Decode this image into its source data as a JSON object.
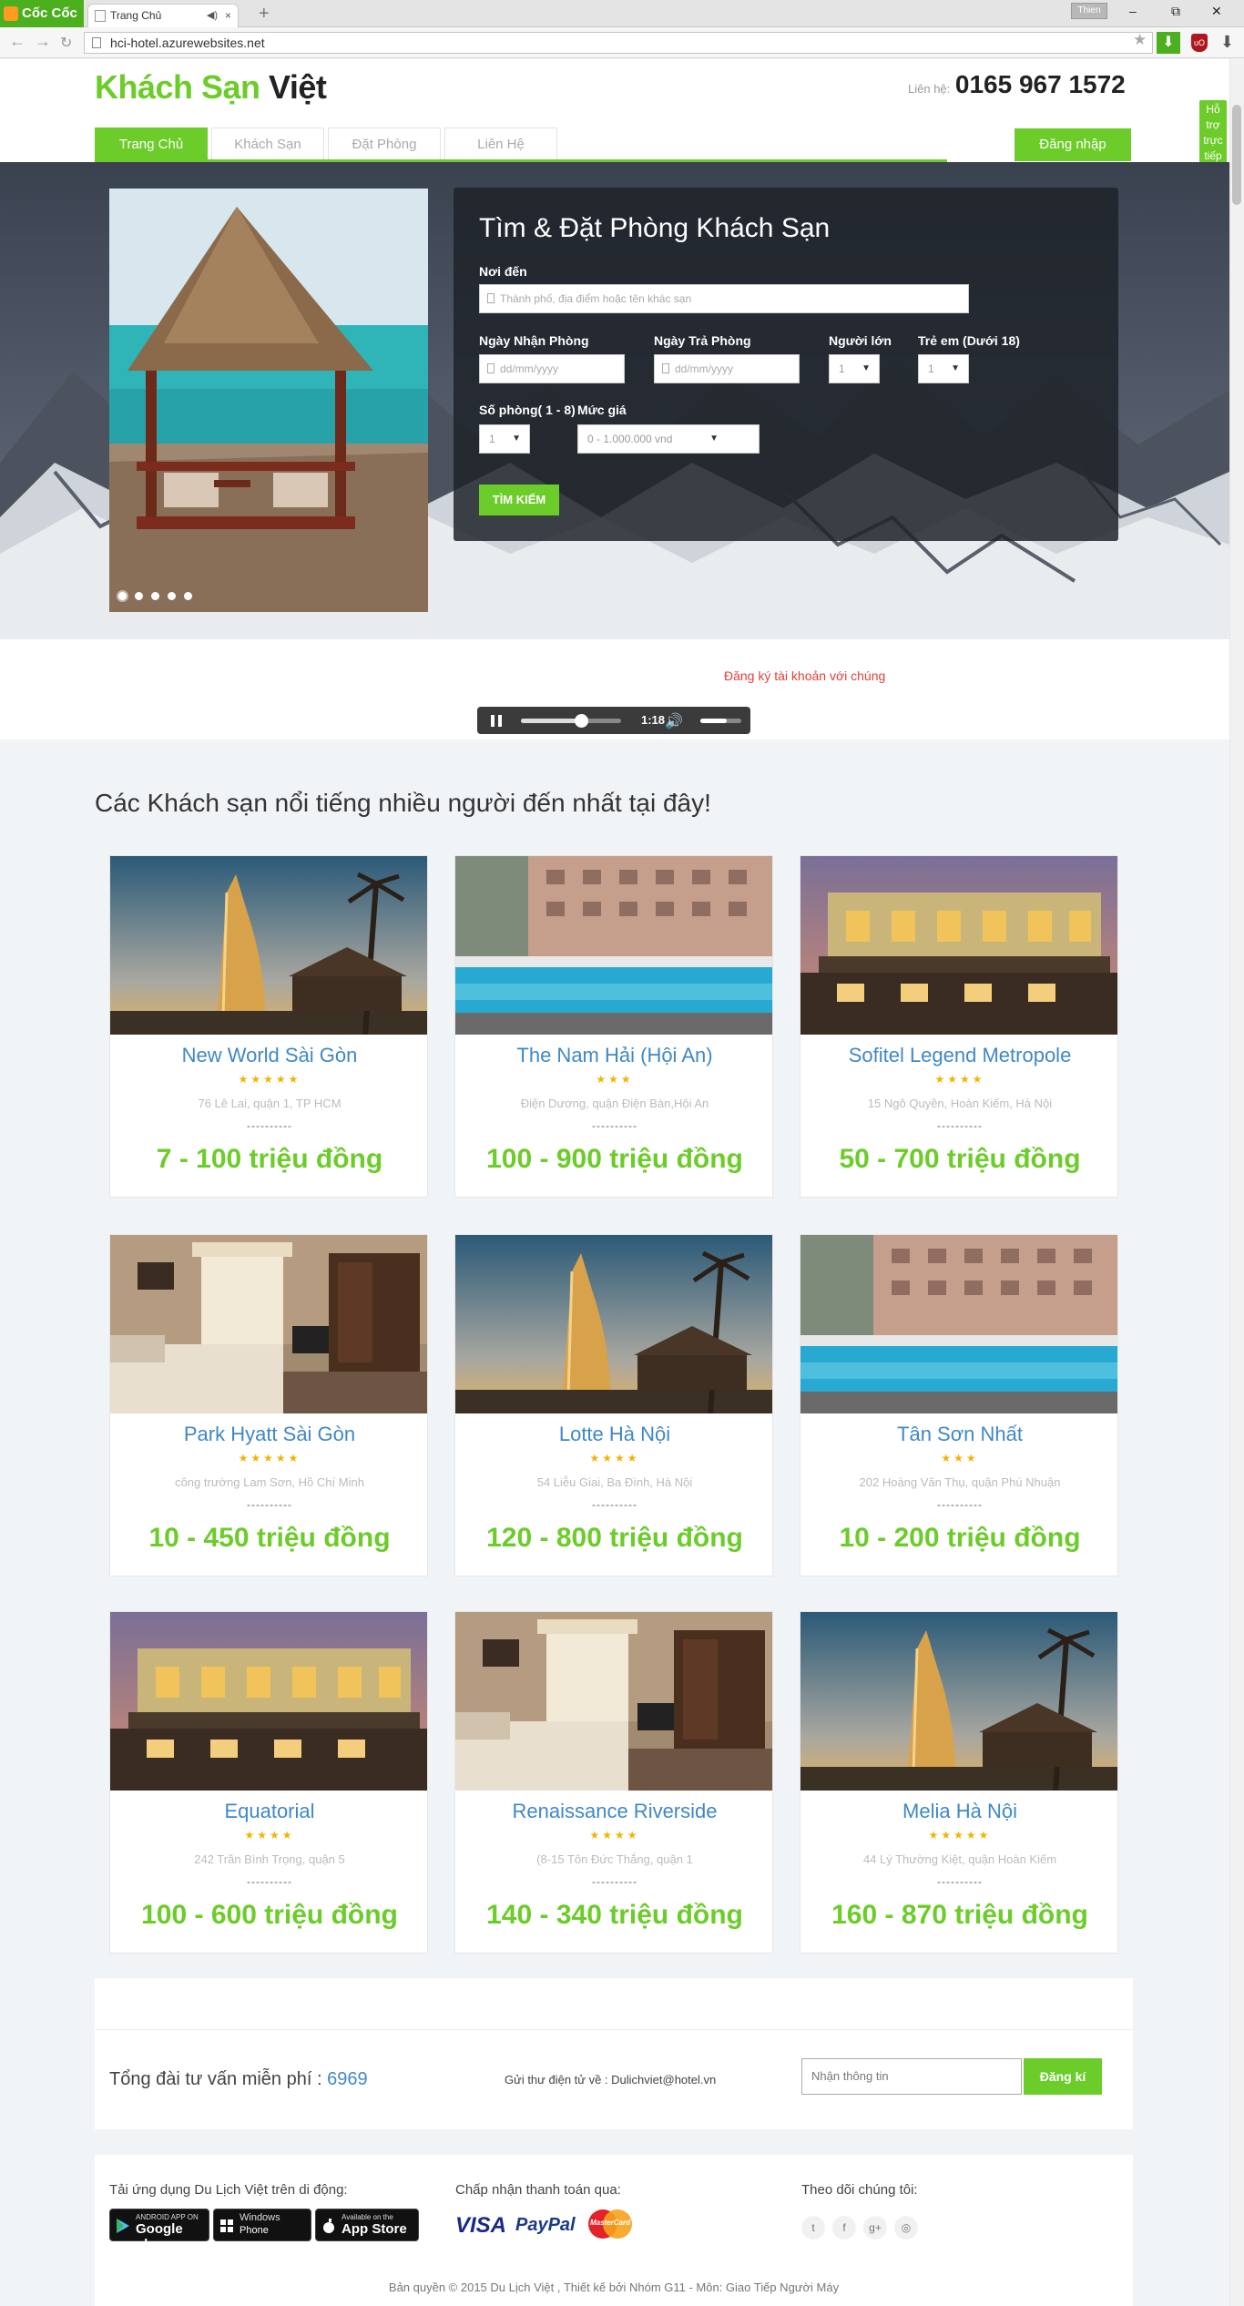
{
  "browser": {
    "brand": "Cốc Cốc",
    "tab_title": "Trang Chủ",
    "tab_sound_icon": "speaker-icon",
    "tab_close": "×",
    "new_tab": "+",
    "user_badge": "Thien",
    "url": "hci-hotel.azurewebsites.net",
    "win_min": "–",
    "win_max": "⧉",
    "win_close": "✕"
  },
  "header": {
    "logo_part1": "Khách Sạn",
    "logo_part2": " Việt",
    "contact_label": "Liên hệ:",
    "contact_phone": "0165 967 1572",
    "nav": [
      {
        "label": "Trang Chủ",
        "active": true
      },
      {
        "label": "Khách Sạn",
        "active": false
      },
      {
        "label": "Đặt Phòng",
        "active": false
      },
      {
        "label": "Liên Hệ",
        "active": false
      }
    ],
    "login_label": "Đăng nhập",
    "support_label": "Hỗ trợ trực tiếp"
  },
  "search": {
    "title": "Tìm & Đặt Phòng Khách Sạn",
    "destination_label": "Nơi đến",
    "destination_placeholder": "Thành phố, địa điểm hoặc tên khác sạn",
    "checkin_label": "Ngày Nhận Phòng",
    "checkin_placeholder": "dd/mm/yyyy",
    "checkout_label": "Ngày Trả Phòng",
    "checkout_placeholder": "dd/mm/yyyy",
    "adults_label": "Người lớn",
    "adults_value": "1",
    "children_label": "Trẻ em (Dưới 18)",
    "children_value": "1",
    "rooms_label": "Số phòng( 1 - 8)",
    "rooms_value": "1",
    "price_label": "Mức giá",
    "price_value": "0 - 1.000.000 vnd",
    "search_button": "TÌM KIẾM"
  },
  "slider": {
    "dots": 5,
    "active_dot": 0
  },
  "register": {
    "link": "Đăng ký tài khoản với chúng"
  },
  "player": {
    "time": "1:18",
    "progress": 0.6,
    "volume": 0.65
  },
  "hotels": {
    "section_title": "Các Khách sạn nổi tiếng nhiều người đến nhất tại đây!",
    "separator": "----------",
    "items": [
      {
        "name": "New World Sài Gòn",
        "stars": "★★★★★",
        "address": "76 Lê Lai, quận 1, TP HCM",
        "price": "7 - 100 triệu đồng",
        "image": "burj"
      },
      {
        "name": "The Nam Hải (Hội An)",
        "stars": "★★★",
        "address": "Điện Dương, quận Điện Bàn,Hội An",
        "price": "100 - 900 triệu đồng",
        "image": "pool"
      },
      {
        "name": "Sofitel Legend Metropole",
        "stars": "★★★★",
        "address": "15 Ngô Quyền, Hoàn Kiếm, Hà Nội",
        "price": "50 - 700 triệu đồng",
        "image": "facade"
      },
      {
        "name": "Park Hyatt Sài Gòn",
        "stars": "★★★★★",
        "address": "công trường Lam Sơn, Hồ Chí Minh",
        "price": "10 - 450 triệu đồng",
        "image": "room"
      },
      {
        "name": "Lotte Hà Nội",
        "stars": "★★★★",
        "address": "54 Liễu Giai, Ba Đình, Hà Nội",
        "price": "120 - 800 triệu đồng",
        "image": "burj"
      },
      {
        "name": "Tân Sơn Nhất",
        "stars": "★★★",
        "address": "202 Hoàng Văn Thụ, quận Phú Nhuận",
        "price": "10 - 200 triệu đồng",
        "image": "pool"
      },
      {
        "name": "Equatorial",
        "stars": "★★★★",
        "address": "242 Trần Bình Trọng, quận 5",
        "price": "100 - 600 triệu đồng",
        "image": "facade"
      },
      {
        "name": "Renaissance Riverside",
        "stars": "★★★★",
        "address": "(8-15 Tôn Đức Thắng, quận 1",
        "price": "140 - 340 triệu đồng",
        "image": "room"
      },
      {
        "name": "Melia Hà Nội",
        "stars": "★★★★★",
        "address": "44 Lý Thường Kiệt, quận Hoàn Kiếm",
        "price": "160 - 870 triệu đồng",
        "image": "burj"
      }
    ]
  },
  "newsletter": {
    "hotline_label": "Tổng đài tư vấn miễn phí :",
    "hotline_number": "6969",
    "email_text": "Gửi thư điện tử về : Dulichviet@hotel.vn",
    "input_placeholder": "Nhận thông tin",
    "subscribe_button": "Đăng kí"
  },
  "footer": {
    "apps_heading": "Tải ứng dụng Du Lịch Việt trên di động:",
    "stores": [
      {
        "small": "ANDROID APP ON",
        "big": "Google play",
        "icon": "play-store-icon"
      },
      {
        "small": "Windows",
        "big": "Phone",
        "icon": "windows-icon"
      },
      {
        "small": "Available on the",
        "big": "App Store",
        "icon": "apple-icon"
      }
    ],
    "payment_heading": "Chấp nhận thanh toán qua:",
    "payments": {
      "visa": "VISA",
      "paypal": "PayPal",
      "mastercard": "MasterCard"
    },
    "follow_heading": "Theo dõi chúng tôi:",
    "socials": [
      {
        "glyph": "t",
        "icon": "twitter-icon"
      },
      {
        "glyph": "f",
        "icon": "facebook-icon"
      },
      {
        "glyph": "g+",
        "icon": "google-plus-icon"
      },
      {
        "glyph": "◎",
        "icon": "dribbble-icon"
      }
    ],
    "copyright": "Bản quyền © 2015 Du Lịch Việt , Thiết kế bởi Nhóm G11 - Môn: Giao Tiếp Người Máy"
  },
  "colors": {
    "accent": "#6ccc2a",
    "link": "#3f88c8",
    "alert": "#e0403c",
    "panel": "#1e2228"
  }
}
